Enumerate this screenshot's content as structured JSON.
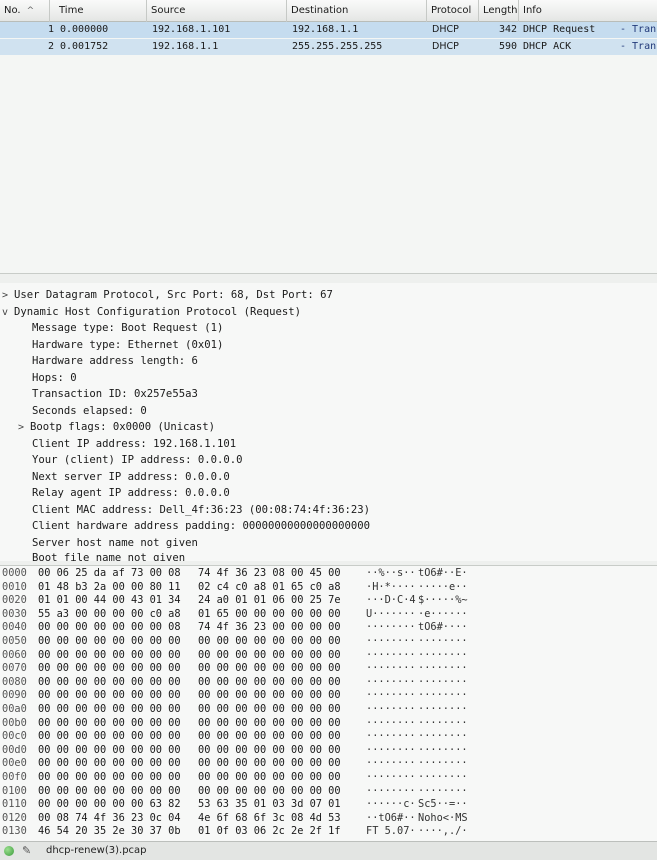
{
  "packet_list": {
    "columns": [
      "No.",
      "Time",
      "Source",
      "Destination",
      "Protocol",
      "Length",
      "Info"
    ],
    "rows": [
      {
        "no": "1",
        "time": "0.000000",
        "source": "192.168.1.101",
        "destination": "192.168.1.1",
        "protocol": "DHCP",
        "length": "342",
        "info": "DHCP Request",
        "extra": "- Tran"
      },
      {
        "no": "2",
        "time": "0.001752",
        "source": "192.168.1.1",
        "destination": "255.255.255.255",
        "protocol": "DHCP",
        "length": "590",
        "info": "DHCP ACK",
        "extra": "- Tran"
      }
    ]
  },
  "details": {
    "lines": [
      {
        "arrow": ">",
        "text": "User Datagram Protocol, Src Port: 68, Dst Port: 67"
      },
      {
        "arrow": "v",
        "text": "Dynamic Host Configuration Protocol (Request)"
      },
      {
        "arrow": "",
        "text": "Message type: Boot Request (1)"
      },
      {
        "arrow": "",
        "text": "Hardware type: Ethernet (0x01)"
      },
      {
        "arrow": "",
        "text": "Hardware address length: 6"
      },
      {
        "arrow": "",
        "text": "Hops: 0"
      },
      {
        "arrow": "",
        "text": "Transaction ID: 0x257e55a3"
      },
      {
        "arrow": "",
        "text": "Seconds elapsed: 0"
      },
      {
        "arrow": ">",
        "text": "Bootp flags: 0x0000 (Unicast)"
      },
      {
        "arrow": "",
        "text": "Client IP address: 192.168.1.101"
      },
      {
        "arrow": "",
        "text": "Your (client) IP address: 0.0.0.0"
      },
      {
        "arrow": "",
        "text": "Next server IP address: 0.0.0.0"
      },
      {
        "arrow": "",
        "text": "Relay agent IP address: 0.0.0.0"
      },
      {
        "arrow": "",
        "text": "Client MAC address: Dell_4f:36:23 (00:08:74:4f:36:23)"
      },
      {
        "arrow": "",
        "text": "Client hardware address padding: 00000000000000000000"
      },
      {
        "arrow": "",
        "text": "Server host name not given"
      },
      {
        "arrow": "",
        "text": "Boot file name not given"
      }
    ]
  },
  "hex": {
    "rows": [
      {
        "off": "0000",
        "b1": "00 06 25 da af 73 00 08",
        "b2": "74 4f 36 23 08 00 45 00",
        "a1": "··%··s··",
        "a2": "tO6#··E·"
      },
      {
        "off": "0010",
        "b1": "01 48 b3 2a 00 00 80 11",
        "b2": "02 c4 c0 a8 01 65 c0 a8",
        "a1": "·H·*····",
        "a2": "·····e··"
      },
      {
        "off": "0020",
        "b1": "01 01 00 44 00 43 01 34",
        "b2": "24 a0 01 01 06 00 25 7e",
        "a1": "···D·C·4",
        "a2": "$·····%~"
      },
      {
        "off": "0030",
        "b1": "55 a3 00 00 00 00 c0 a8",
        "b2": "01 65 00 00 00 00 00 00",
        "a1": "U·······",
        "a2": "·e······"
      },
      {
        "off": "0040",
        "b1": "00 00 00 00 00 00 00 08",
        "b2": "74 4f 36 23 00 00 00 00",
        "a1": "········",
        "a2": "tO6#····"
      },
      {
        "off": "0050",
        "b1": "00 00 00 00 00 00 00 00",
        "b2": "00 00 00 00 00 00 00 00",
        "a1": "········",
        "a2": "········"
      },
      {
        "off": "0060",
        "b1": "00 00 00 00 00 00 00 00",
        "b2": "00 00 00 00 00 00 00 00",
        "a1": "········",
        "a2": "········"
      },
      {
        "off": "0070",
        "b1": "00 00 00 00 00 00 00 00",
        "b2": "00 00 00 00 00 00 00 00",
        "a1": "········",
        "a2": "········"
      },
      {
        "off": "0080",
        "b1": "00 00 00 00 00 00 00 00",
        "b2": "00 00 00 00 00 00 00 00",
        "a1": "········",
        "a2": "········"
      },
      {
        "off": "0090",
        "b1": "00 00 00 00 00 00 00 00",
        "b2": "00 00 00 00 00 00 00 00",
        "a1": "········",
        "a2": "········"
      },
      {
        "off": "00a0",
        "b1": "00 00 00 00 00 00 00 00",
        "b2": "00 00 00 00 00 00 00 00",
        "a1": "········",
        "a2": "········"
      },
      {
        "off": "00b0",
        "b1": "00 00 00 00 00 00 00 00",
        "b2": "00 00 00 00 00 00 00 00",
        "a1": "········",
        "a2": "········"
      },
      {
        "off": "00c0",
        "b1": "00 00 00 00 00 00 00 00",
        "b2": "00 00 00 00 00 00 00 00",
        "a1": "········",
        "a2": "········"
      },
      {
        "off": "00d0",
        "b1": "00 00 00 00 00 00 00 00",
        "b2": "00 00 00 00 00 00 00 00",
        "a1": "········",
        "a2": "········"
      },
      {
        "off": "00e0",
        "b1": "00 00 00 00 00 00 00 00",
        "b2": "00 00 00 00 00 00 00 00",
        "a1": "········",
        "a2": "········"
      },
      {
        "off": "00f0",
        "b1": "00 00 00 00 00 00 00 00",
        "b2": "00 00 00 00 00 00 00 00",
        "a1": "········",
        "a2": "········"
      },
      {
        "off": "0100",
        "b1": "00 00 00 00 00 00 00 00",
        "b2": "00 00 00 00 00 00 00 00",
        "a1": "········",
        "a2": "········"
      },
      {
        "off": "0110",
        "b1": "00 00 00 00 00 00 63 82",
        "b2": "53 63 35 01 03 3d 07 01",
        "a1": "······c·",
        "a2": "Sc5··=··"
      },
      {
        "off": "0120",
        "b1": "00 08 74 4f 36 23 0c 04",
        "b2": "4e 6f 68 6f 3c 08 4d 53",
        "a1": "··tO6#··",
        "a2": "Noho<·MS"
      },
      {
        "off": "0130",
        "b1": "46 54 20 35 2e 30 37 0b",
        "b2": "01 0f 03 06 2c 2e 2f 1f",
        "a1": "FT 5.07·",
        "a2": "····,./·"
      }
    ]
  },
  "status": {
    "file": "dhcp-renew(3).pcap"
  }
}
